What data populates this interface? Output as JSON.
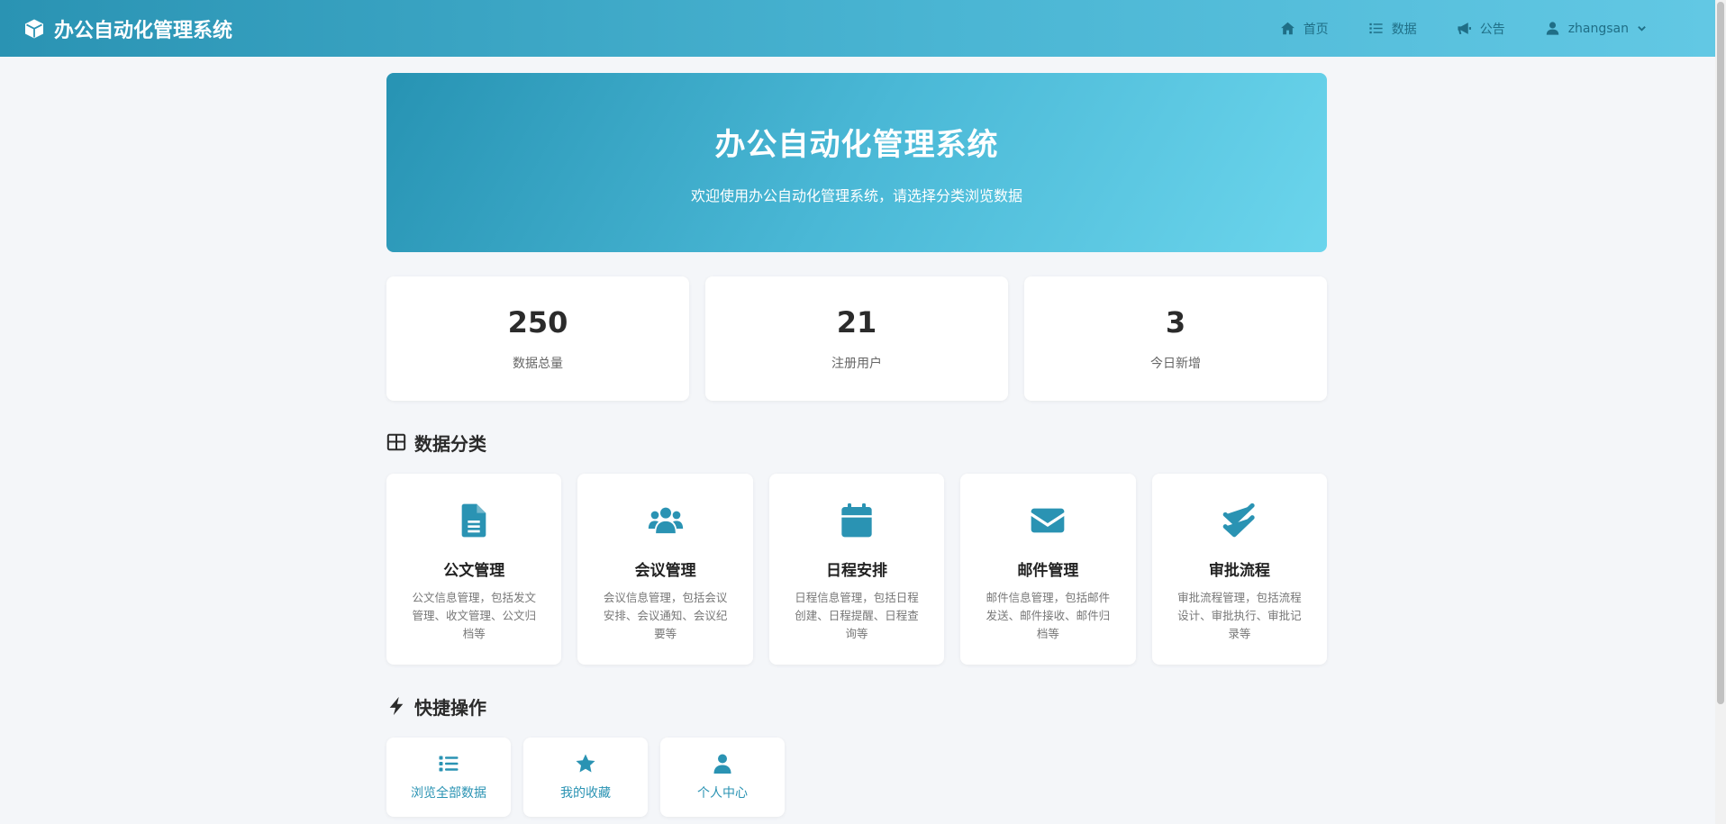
{
  "navbar": {
    "brand": "办公自动化管理系统",
    "links": [
      {
        "label": "首页",
        "icon": "home-icon"
      },
      {
        "label": "数据",
        "icon": "list-icon"
      },
      {
        "label": "公告",
        "icon": "megaphone-icon"
      }
    ],
    "user": {
      "name": "zhangsan",
      "icon": "user-icon"
    }
  },
  "hero": {
    "title": "办公自动化管理系统",
    "subtitle": "欢迎使用办公自动化管理系统，请选择分类浏览数据"
  },
  "stats": [
    {
      "value": "250",
      "label": "数据总量"
    },
    {
      "value": "21",
      "label": "注册用户"
    },
    {
      "value": "3",
      "label": "今日新增"
    }
  ],
  "categories_section": {
    "title": "数据分类",
    "items": [
      {
        "name": "公文管理",
        "icon": "document-icon",
        "desc": "公文信息管理，包括发文管理、收文管理、公文归档等"
      },
      {
        "name": "会议管理",
        "icon": "users-icon",
        "desc": "会议信息管理，包括会议安排、会议通知、会议纪要等"
      },
      {
        "name": "日程安排",
        "icon": "calendar-icon",
        "desc": "日程信息管理，包括日程创建、日程提醒、日程查询等"
      },
      {
        "name": "邮件管理",
        "icon": "envelope-icon",
        "desc": "邮件信息管理，包括邮件发送、邮件接收、邮件归档等"
      },
      {
        "name": "审批流程",
        "icon": "check-double-icon",
        "desc": "审批流程管理，包括流程设计、审批执行、审批记录等"
      }
    ]
  },
  "quick_section": {
    "title": "快捷操作",
    "items": [
      {
        "label": "浏览全部数据",
        "icon": "list-icon"
      },
      {
        "label": "我的收藏",
        "icon": "star-icon"
      },
      {
        "label": "个人中心",
        "icon": "user-icon"
      }
    ]
  },
  "colors": {
    "primary": "#2a93b3",
    "nav_text": "#1f6e86",
    "background": "#f4f6f9"
  }
}
